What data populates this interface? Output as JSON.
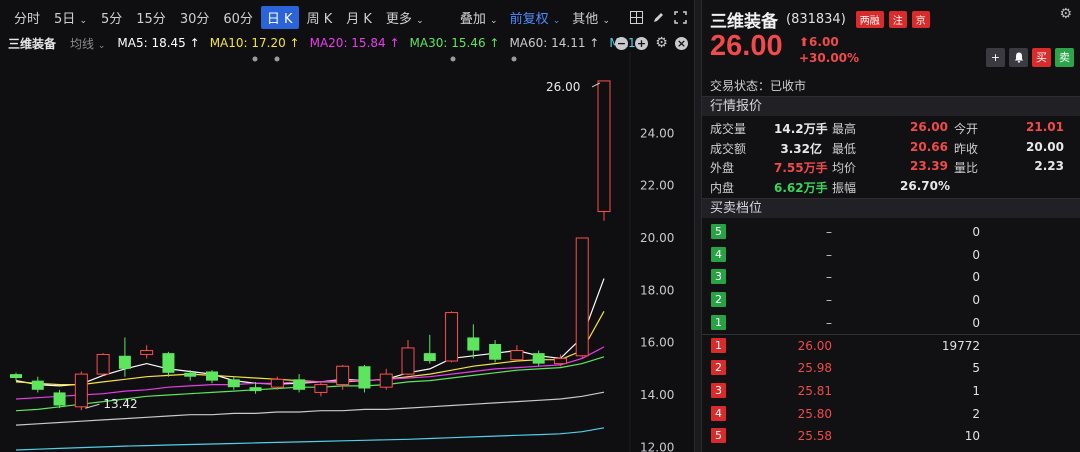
{
  "toolbar": {
    "periods": [
      "分时",
      "5日",
      "5分",
      "15分",
      "30分",
      "60分",
      "日 K",
      "周 K",
      "月 K",
      "更多"
    ],
    "active_period": "日 K",
    "overlay": "叠加",
    "adjust": "前复权",
    "other": "其他"
  },
  "ma_bar": {
    "stock_name": "三维装备",
    "avg_line_label": "均线",
    "ma5": "MA5: 18.45 ↑",
    "ma10": "MA10: 17.20 ↑",
    "ma20": "MA20: 15.84 ↑",
    "ma30": "MA30: 15.46 ↑",
    "ma60": "MA60: 14.11 ↑",
    "ma120": "MA12",
    "colors": {
      "ma5": "#ffffff",
      "ma10": "#f5e43a",
      "ma20": "#e83ce8",
      "ma30": "#5ee55e",
      "ma60": "#c9c9c9",
      "ma120": "#4fd0e8"
    }
  },
  "chart_data": {
    "type": "candlestick",
    "y_ticks": [
      "24.00",
      "22.00",
      "20.00",
      "18.00",
      "16.00",
      "14.00",
      "12.00"
    ],
    "ylim": [
      11.9,
      26.8
    ],
    "up_color": "#ff4d4d",
    "down_color": "#5ee55e",
    "max_label": "26.00",
    "min_label": "13.42",
    "candles": [
      {
        "o": 14.8,
        "c": 14.65,
        "h": 14.85,
        "l": 14.55
      },
      {
        "o": 14.55,
        "c": 14.2,
        "h": 14.7,
        "l": 14.1
      },
      {
        "o": 14.1,
        "c": 13.6,
        "h": 14.2,
        "l": 13.5
      },
      {
        "o": 13.55,
        "c": 14.8,
        "h": 14.9,
        "l": 13.42
      },
      {
        "o": 14.8,
        "c": 15.55,
        "h": 15.6,
        "l": 14.75
      },
      {
        "o": 15.5,
        "c": 15.0,
        "h": 16.2,
        "l": 14.7
      },
      {
        "o": 15.55,
        "c": 15.7,
        "h": 15.9,
        "l": 15.4
      },
      {
        "o": 15.6,
        "c": 14.85,
        "h": 15.65,
        "l": 14.7
      },
      {
        "o": 14.85,
        "c": 14.7,
        "h": 14.95,
        "l": 14.55
      },
      {
        "o": 14.9,
        "c": 14.55,
        "h": 14.95,
        "l": 14.45
      },
      {
        "o": 14.6,
        "c": 14.3,
        "h": 14.7,
        "l": 14.2
      },
      {
        "o": 14.3,
        "c": 14.15,
        "h": 14.5,
        "l": 14.05
      },
      {
        "o": 14.3,
        "c": 14.6,
        "h": 14.7,
        "l": 14.2
      },
      {
        "o": 14.6,
        "c": 14.2,
        "h": 14.8,
        "l": 14.1
      },
      {
        "o": 14.1,
        "c": 14.4,
        "h": 14.5,
        "l": 13.95
      },
      {
        "o": 14.4,
        "c": 15.1,
        "h": 15.15,
        "l": 14.2
      },
      {
        "o": 15.1,
        "c": 14.25,
        "h": 15.15,
        "l": 14.1
      },
      {
        "o": 14.3,
        "c": 14.8,
        "h": 15.0,
        "l": 14.2
      },
      {
        "o": 14.8,
        "c": 15.8,
        "h": 16.1,
        "l": 14.75
      },
      {
        "o": 15.6,
        "c": 15.3,
        "h": 16.3,
        "l": 15.2
      },
      {
        "o": 15.3,
        "c": 17.15,
        "h": 17.2,
        "l": 15.25
      },
      {
        "o": 16.2,
        "c": 15.7,
        "h": 16.7,
        "l": 15.4
      },
      {
        "o": 15.95,
        "c": 15.35,
        "h": 16.1,
        "l": 15.25
      },
      {
        "o": 15.35,
        "c": 15.7,
        "h": 15.9,
        "l": 15.3
      },
      {
        "o": 15.6,
        "c": 15.2,
        "h": 15.7,
        "l": 15.1
      },
      {
        "o": 15.2,
        "c": 15.4,
        "h": 15.55,
        "l": 15.1
      },
      {
        "o": 15.5,
        "c": 20.0,
        "h": 20.0,
        "l": 15.4
      },
      {
        "o": 21.01,
        "c": 26.0,
        "h": 26.0,
        "l": 20.66
      }
    ],
    "ma_series": {
      "ma5": [
        14.55,
        14.4,
        14.35,
        14.42,
        14.75,
        15.0,
        15.2,
        15.0,
        14.9,
        14.8,
        14.55,
        14.45,
        14.42,
        14.45,
        14.5,
        14.6,
        14.55,
        14.6,
        14.85,
        15.0,
        15.4,
        15.5,
        15.6,
        15.7,
        15.5,
        15.4,
        16.2,
        18.45
      ],
      "ma10": [
        14.5,
        14.45,
        14.4,
        14.4,
        14.5,
        14.6,
        14.7,
        14.75,
        14.8,
        14.75,
        14.7,
        14.65,
        14.6,
        14.55,
        14.5,
        14.5,
        14.55,
        14.6,
        14.7,
        14.8,
        14.95,
        15.1,
        15.2,
        15.3,
        15.35,
        15.35,
        15.7,
        17.2
      ],
      "ma20": [
        13.85,
        13.9,
        13.95,
        14.0,
        14.05,
        14.15,
        14.2,
        14.3,
        14.35,
        14.4,
        14.4,
        14.45,
        14.45,
        14.5,
        14.5,
        14.55,
        14.55,
        14.6,
        14.65,
        14.7,
        14.8,
        14.9,
        15.0,
        15.05,
        15.1,
        15.15,
        15.4,
        15.84
      ],
      "ma30": [
        13.4,
        13.45,
        13.55,
        13.65,
        13.75,
        13.85,
        13.95,
        14.0,
        14.05,
        14.1,
        14.15,
        14.2,
        14.25,
        14.3,
        14.3,
        14.35,
        14.35,
        14.4,
        14.5,
        14.55,
        14.65,
        14.75,
        14.85,
        14.95,
        15.0,
        15.05,
        15.2,
        15.46
      ],
      "ma60": [
        12.85,
        12.9,
        12.95,
        13.0,
        13.05,
        13.1,
        13.15,
        13.2,
        13.25,
        13.25,
        13.3,
        13.3,
        13.35,
        13.35,
        13.4,
        13.4,
        13.45,
        13.45,
        13.5,
        13.55,
        13.6,
        13.65,
        13.7,
        13.75,
        13.8,
        13.85,
        13.95,
        14.11
      ],
      "ma120": [
        11.9,
        11.93,
        11.96,
        11.99,
        12.02,
        12.05,
        12.07,
        12.09,
        12.11,
        12.13,
        12.15,
        12.17,
        12.19,
        12.21,
        12.23,
        12.25,
        12.27,
        12.29,
        12.31,
        12.34,
        12.37,
        12.4,
        12.43,
        12.46,
        12.49,
        12.52,
        12.6,
        12.75
      ]
    }
  },
  "quote": {
    "name": "三维装备",
    "code": "(831834)",
    "tags": [
      "两融",
      "注",
      "京"
    ],
    "price": "26.00",
    "change": "⬆6.00",
    "change_pct": "+30.00%",
    "btn_add": "+",
    "btn_alert": "🔔",
    "btn_buy": "买",
    "btn_sell": "卖",
    "status": "交易状态：已收市",
    "section_quotes": "行情报价",
    "section_orderbook": "买卖档位",
    "stats": [
      [
        {
          "l": "成交量",
          "v": "14.2万手",
          "c": "white"
        },
        {
          "l": "最高",
          "v": "26.00",
          "c": "red"
        },
        {
          "l": "今开",
          "v": "21.01",
          "c": "red"
        }
      ],
      [
        {
          "l": "成交额",
          "v": "3.32亿",
          "c": "white"
        },
        {
          "l": "最低",
          "v": "20.66",
          "c": "red"
        },
        {
          "l": "昨收",
          "v": "20.00",
          "c": "white"
        }
      ],
      [
        {
          "l": "外盘",
          "v": "7.55万手",
          "c": "red"
        },
        {
          "l": "均价",
          "v": "23.39",
          "c": "red"
        },
        {
          "l": "量比",
          "v": "2.23",
          "c": "white"
        }
      ],
      [
        {
          "l": "内盘",
          "v": "6.62万手",
          "c": "green"
        },
        {
          "l": "振幅",
          "v": "26.70%",
          "c": "white"
        },
        {
          "l": "",
          "v": "",
          "c": "white"
        }
      ]
    ],
    "asks": [
      {
        "level": "5",
        "price": "–",
        "vol": "0"
      },
      {
        "level": "4",
        "price": "–",
        "vol": "0"
      },
      {
        "level": "3",
        "price": "–",
        "vol": "0"
      },
      {
        "level": "2",
        "price": "–",
        "vol": "0"
      },
      {
        "level": "1",
        "price": "–",
        "vol": "0"
      }
    ],
    "bids": [
      {
        "level": "1",
        "price": "26.00",
        "vol": "19772"
      },
      {
        "level": "2",
        "price": "25.98",
        "vol": "5"
      },
      {
        "level": "3",
        "price": "25.81",
        "vol": "1"
      },
      {
        "level": "4",
        "price": "25.80",
        "vol": "2"
      },
      {
        "level": "5",
        "price": "25.58",
        "vol": "10"
      }
    ]
  }
}
